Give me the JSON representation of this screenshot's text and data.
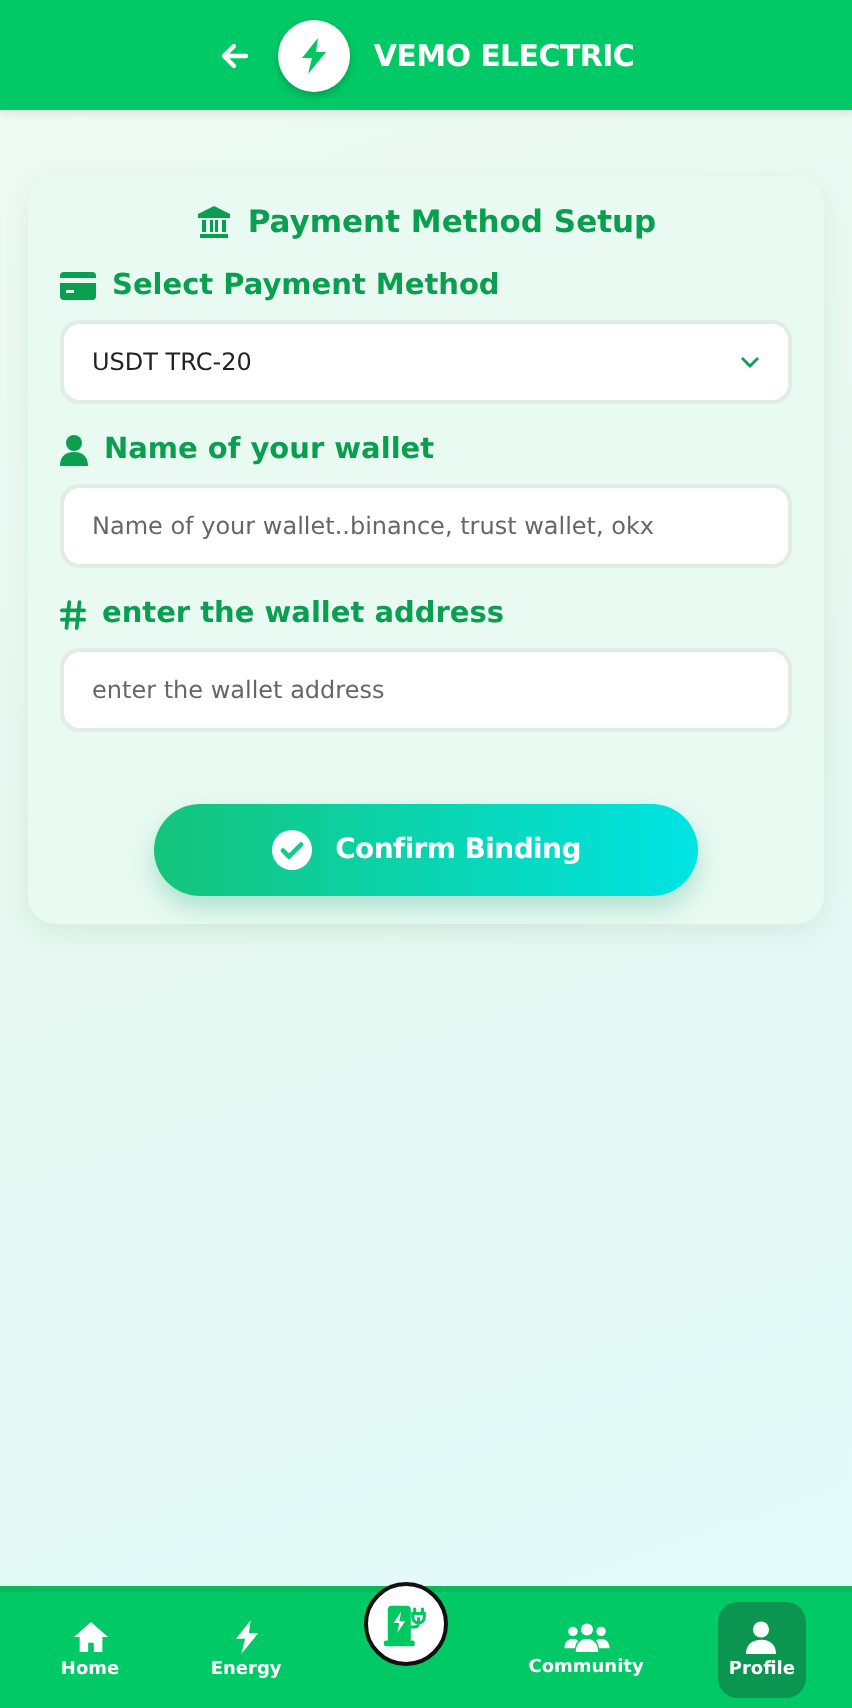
{
  "header": {
    "title": "VEMO ELECTRIC"
  },
  "form": {
    "title": "Payment Method Setup",
    "fields": [
      {
        "kind": "select",
        "label": "Select Payment Method",
        "value": "USDT TRC-20"
      },
      {
        "kind": "text",
        "label": "Name of your wallet",
        "placeholder": "Name of your wallet..binance, trust wallet, okx"
      },
      {
        "kind": "text",
        "label": "enter the wallet address",
        "placeholder": "enter the wallet address"
      }
    ],
    "button": "Confirm Binding"
  },
  "nav": [
    {
      "kind": "home",
      "label": "Home",
      "selected": false
    },
    {
      "kind": "energy",
      "label": "Energy",
      "selected": false
    },
    {
      "kind": "center",
      "selected": false
    },
    {
      "kind": "community",
      "label": "Community",
      "selected": false
    },
    {
      "kind": "profile",
      "label": "Profile",
      "selected": true
    }
  ]
}
